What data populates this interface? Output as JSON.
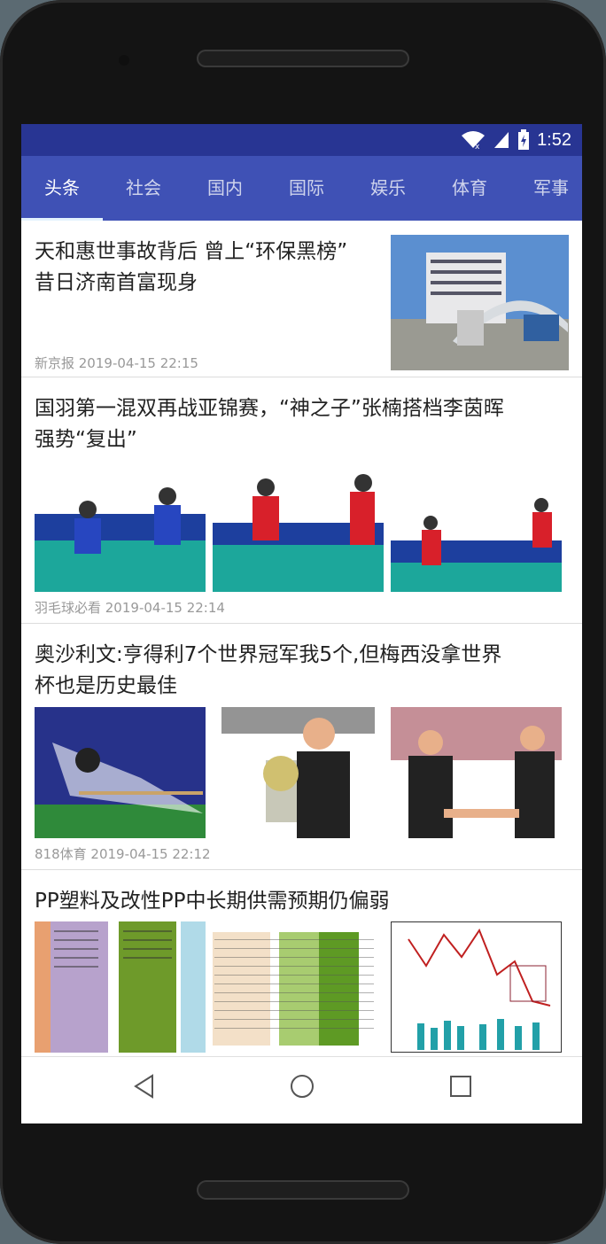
{
  "status": {
    "time": "1:52"
  },
  "tabs": [
    {
      "label": "头条"
    },
    {
      "label": "社会"
    },
    {
      "label": "国内"
    },
    {
      "label": "国际"
    },
    {
      "label": "娱乐"
    },
    {
      "label": "体育"
    },
    {
      "label": "军事"
    }
  ],
  "articles": [
    {
      "title_line1": "天和惠世事故背后 曾上“环保黑榜”",
      "title_line2": "昔日济南首富现身",
      "meta": "新京报 2019-04-15 22:15"
    },
    {
      "title_line1": "国羽第一混双再战亚锦赛，“神之子”张楠搭档李茵晖",
      "title_line2": "强势“复出”",
      "meta": "羽毛球必看 2019-04-15 22:14"
    },
    {
      "title_line1": "奥沙利文:亨得利7个世界冠军我5个,但梅西没拿世界",
      "title_line2": "杯也是历史最佳",
      "meta": "818体育 2019-04-15 22:12"
    },
    {
      "title_line1": "PP塑料及改性PP中长期供需预期仍偏弱"
    }
  ],
  "colors": {
    "statusbar": "#283593",
    "toolbar": "#3f51b5"
  }
}
